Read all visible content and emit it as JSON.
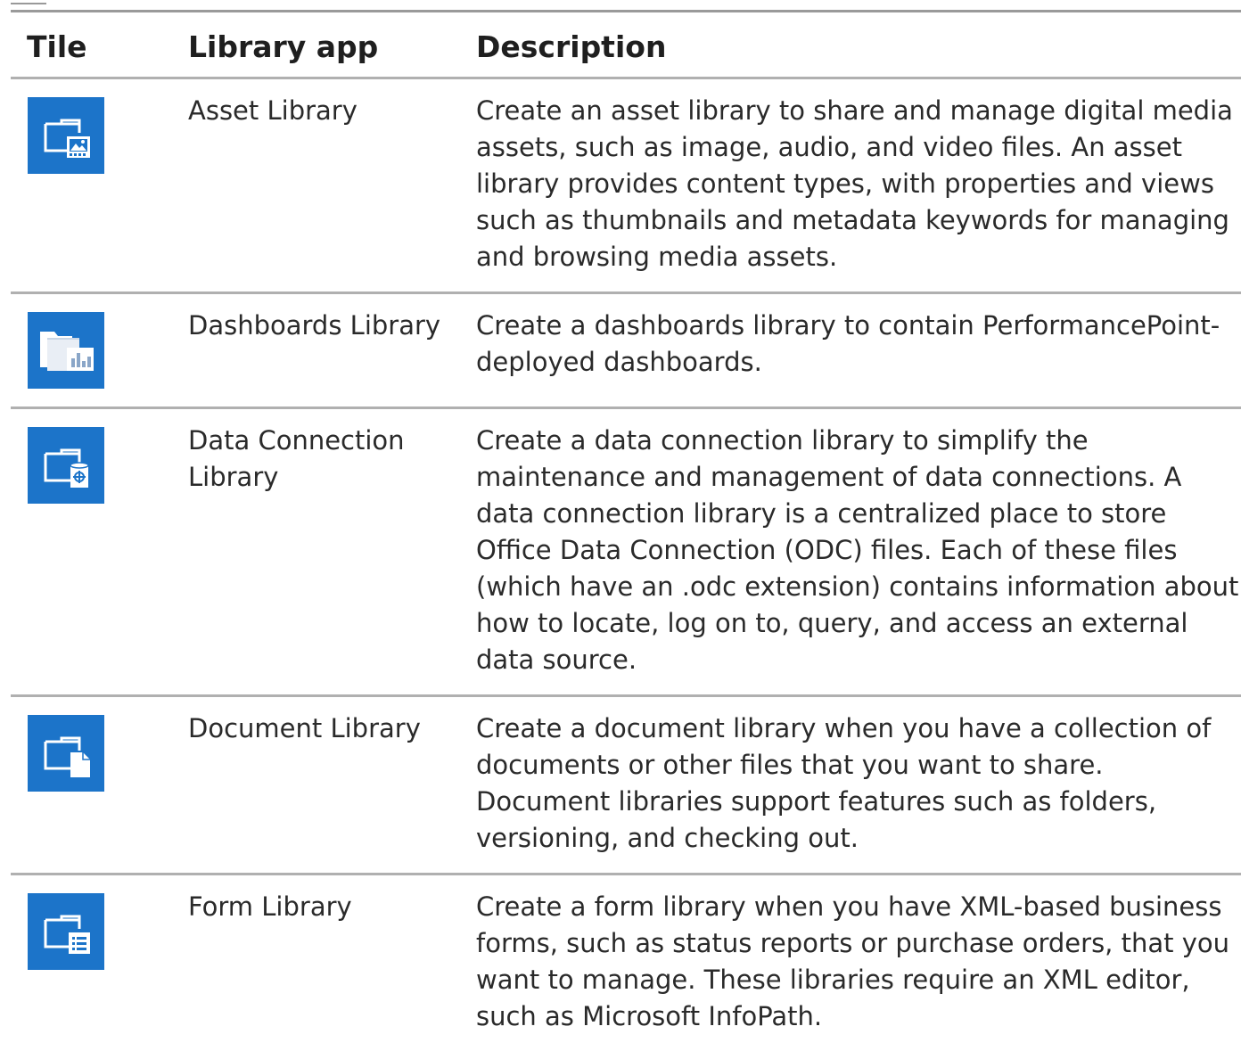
{
  "table": {
    "headers": {
      "tile": "Tile",
      "app": "Library app",
      "description": "Description"
    },
    "rows": [
      {
        "icon": "asset-library-icon",
        "name": "Asset Library",
        "description": "Create an asset library to share and manage digital media assets, such as image, audio, and video files. An asset library provides content types, with properties and views such as thumbnails and metadata keywords for managing and browsing media assets."
      },
      {
        "icon": "dashboards-library-icon",
        "name": "Dashboards Library",
        "description": "Create a dashboards library to contain PerformancePoint-deployed dashboards."
      },
      {
        "icon": "data-connection-library-icon",
        "name": "Data Connection Library",
        "description": "Create a data connection library to simplify the maintenance and management of data connections. A data connection library is a centralized place to store Office Data Connection (ODC) files. Each of these files (which have an .odc extension) contains information about how to locate, log on to, query, and access an external data source."
      },
      {
        "icon": "document-library-icon",
        "name": "Document Library",
        "description": "Create a document library when you have a collection of documents or other files that you want to share. Document libraries support features such as folders, versioning, and checking out."
      },
      {
        "icon": "form-library-icon",
        "name": "Form Library",
        "description": "Create a form library when you have XML-based business forms, such as status reports or purchase orders, that you want to manage. These libraries require an XML editor, such as Microsoft InfoPath."
      }
    ]
  },
  "colors": {
    "tile_blue": "#1c74c9",
    "rule_gray": "#b0b0b0"
  }
}
